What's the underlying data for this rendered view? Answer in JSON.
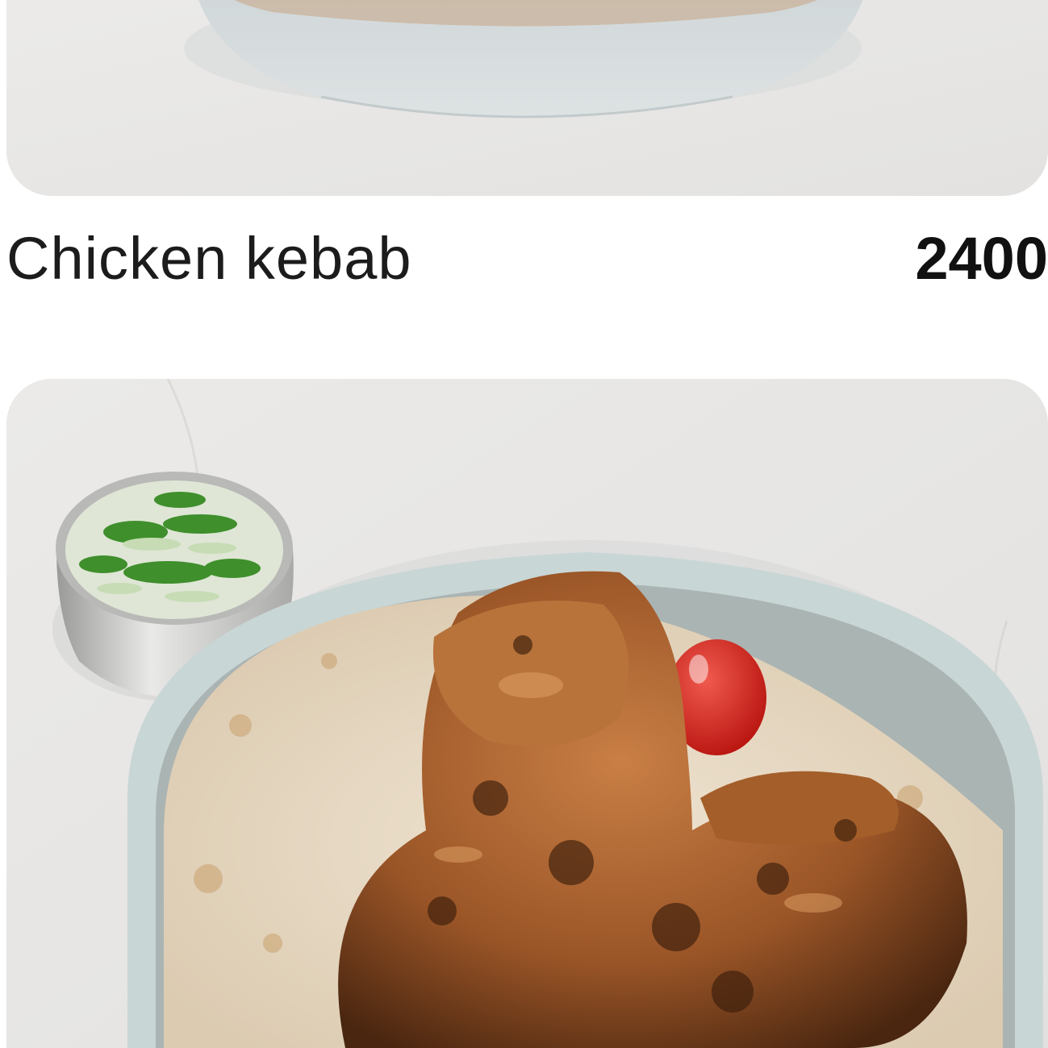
{
  "menu": {
    "items": [
      {
        "name": "Chicken kebab",
        "price": "2400"
      }
    ]
  },
  "colors": {
    "background": "#ffffff",
    "photo_backdrop": "#e9e8e6",
    "name_text": "#1c1c1c",
    "price_text": "#111111"
  },
  "icons": []
}
